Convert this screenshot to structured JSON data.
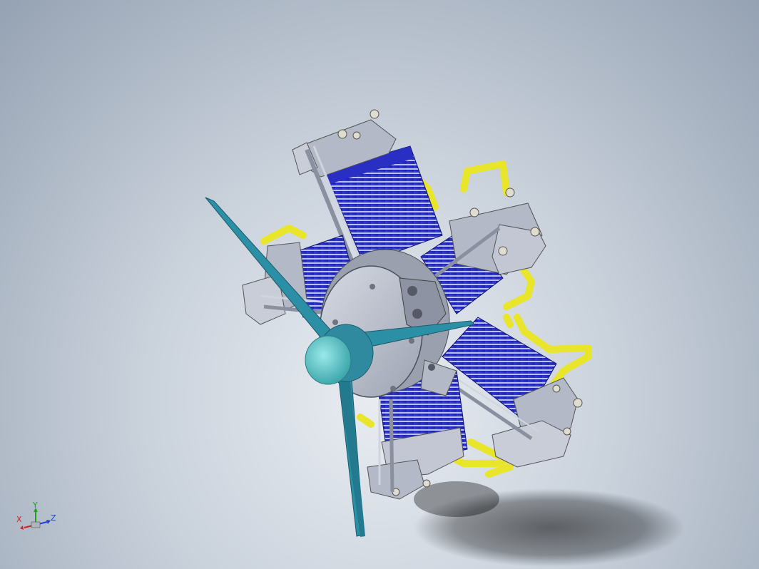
{
  "triad": {
    "x_label": "X",
    "y_label": "Y",
    "z_label": "Z"
  },
  "colors": {
    "background_top": "#95a2b3",
    "background_center": "#e9edf2",
    "cylinder_blue": "#2a2fc4",
    "fin_light": "#a6b1e8",
    "metal_gray": "#b4b9c7",
    "yellow_pipe": "#e8e52b",
    "propeller_teal": "#2b8fa6",
    "spinner_cyan": "#6fd1d1",
    "x_axis": "#d02020",
    "y_axis": "#20a020",
    "z_axis": "#2040d0"
  },
  "model": {
    "icon": "radial-engine-icon"
  }
}
